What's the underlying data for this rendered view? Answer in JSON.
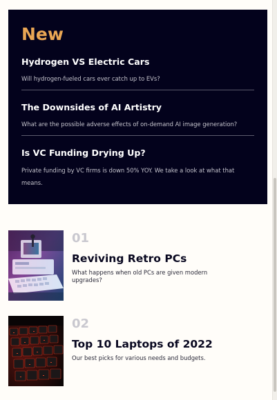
{
  "new_section": {
    "heading": "New",
    "items": [
      {
        "title": "Hydrogen VS Electric Cars",
        "description": "Will hydrogen-fueled cars ever catch up to EVs?"
      },
      {
        "title": "The Downsides of AI Artistry",
        "description": "What are the possible adverse effects of on-demand AI image generation?"
      },
      {
        "title": "Is VC Funding Drying Up?",
        "description": "Private funding by VC firms is down 50% YOY. We take a look at what that means."
      }
    ]
  },
  "articles": [
    {
      "number": "01",
      "title": "Reviving Retro PCs",
      "description": "What happens when old PCs are given modern upgrades?",
      "image": "retro-pc-photo"
    },
    {
      "number": "02",
      "title": "Top 10 Laptops of 2022",
      "description": "Our best picks for various needs and budgets.",
      "image": "laptop-keyboard-photo"
    }
  ],
  "colors": {
    "panel_background": "#03021c",
    "accent": "#e9a654",
    "page_background": "#fffdf9",
    "number_gray": "#c9c8cf"
  }
}
